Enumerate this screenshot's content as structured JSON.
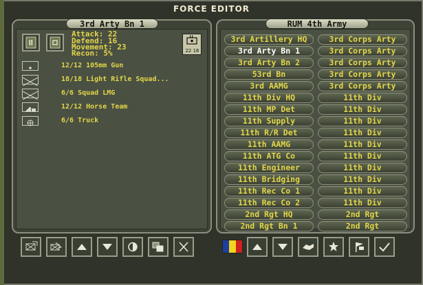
{
  "window": {
    "title": "FORCE EDITOR"
  },
  "colors": {
    "text_yellow": "#e2d64a",
    "text_white": "#ffffff",
    "flag": [
      "#1e3f9e",
      "#f2d51c",
      "#d0221c"
    ]
  },
  "unit_panel": {
    "title": "3rd Arty Bn 1",
    "stats": [
      "Attack: 22",
      "Defend: 16",
      "Movement: 23",
      "Recon: 5%"
    ],
    "counter": {
      "text": "22 16",
      "icon": "artillery-counter-icon"
    },
    "elements": [
      {
        "icon": "gun-icon",
        "text": "12/12 105mm Gun"
      },
      {
        "icon": "infantry-icon",
        "text": "18/18 Light Rifle Squad..."
      },
      {
        "icon": "infantry-icon",
        "text": "6/6 Squad LMG"
      },
      {
        "icon": "horse-team-icon",
        "text": "12/12 Horse Team"
      },
      {
        "icon": "truck-icon",
        "text": "6/6 Truck"
      }
    ],
    "top_buttons": [
      "pause-icon",
      "unit-square-icon"
    ],
    "bottom_buttons": [
      "move-unit-icon",
      "transfer-unit-icon",
      "move-up-icon",
      "move-down-icon",
      "half-circle-icon",
      "copy-icon",
      "delete-icon"
    ]
  },
  "army_panel": {
    "title": "RUM 4th Army",
    "rows": [
      {
        "name": "3rd Artillery HQ",
        "parent": "3rd Corps Arty",
        "selected": false
      },
      {
        "name": "3rd Arty Bn 1",
        "parent": "3rd Corps Arty",
        "selected": true
      },
      {
        "name": "3rd Arty Bn 2",
        "parent": "3rd Corps Arty",
        "selected": false
      },
      {
        "name": "53rd Bn",
        "parent": "3rd Corps Arty",
        "selected": false
      },
      {
        "name": "3rd AAMG",
        "parent": "3rd Corps Arty",
        "selected": false
      },
      {
        "name": "11th Div HQ",
        "parent": "11th Div",
        "selected": false
      },
      {
        "name": "11th MP Det",
        "parent": "11th Div",
        "selected": false
      },
      {
        "name": "11th Supply",
        "parent": "11th Div",
        "selected": false
      },
      {
        "name": "11th R/R Det",
        "parent": "11th Div",
        "selected": false
      },
      {
        "name": "11th AAMG",
        "parent": "11th Div",
        "selected": false
      },
      {
        "name": "11th ATG Co",
        "parent": "11th Div",
        "selected": false
      },
      {
        "name": "11th Engineer",
        "parent": "11th Div",
        "selected": false
      },
      {
        "name": "11th Bridging",
        "parent": "11th Div",
        "selected": false
      },
      {
        "name": "11th Rec Co 1",
        "parent": "11th Div",
        "selected": false
      },
      {
        "name": "11th Rec Co 2",
        "parent": "11th Div",
        "selected": false
      },
      {
        "name": "2nd Rgt HQ",
        "parent": "2nd Rgt",
        "selected": false
      },
      {
        "name": "2nd Rgt Bn 1",
        "parent": "2nd Rgt",
        "selected": false
      }
    ],
    "flag_icon": "romania-flag-icon",
    "bottom_buttons": [
      "move-up-icon",
      "move-down-icon",
      "handshake-icon",
      "star-icon",
      "flags-icon",
      "checkmark-icon"
    ]
  }
}
